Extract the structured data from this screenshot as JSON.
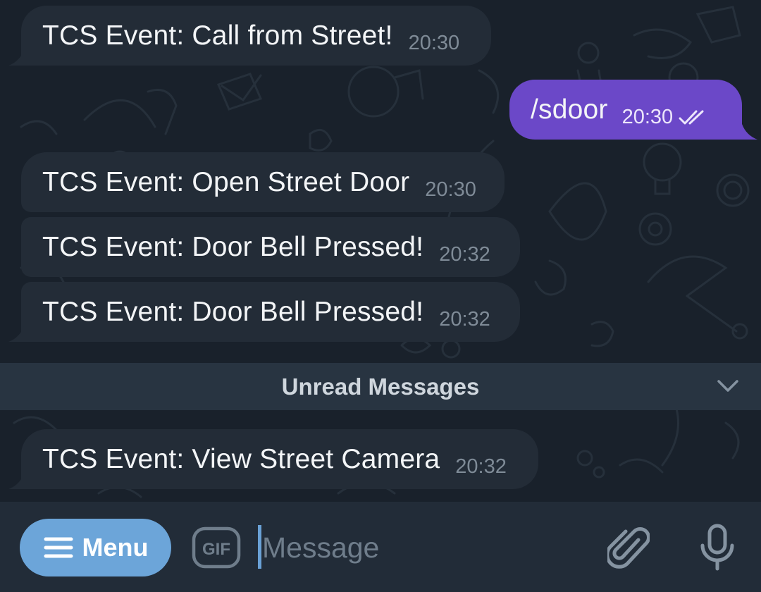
{
  "messages": [
    {
      "text": "TCS Event: Call from Street!",
      "time": "20:30",
      "direction": "incoming"
    },
    {
      "text": "/sdoor",
      "time": "20:30",
      "direction": "outgoing",
      "status": "read"
    },
    {
      "text": "TCS Event: Open Street Door",
      "time": "20:30",
      "direction": "incoming"
    },
    {
      "text": "TCS Event: Door Bell Pressed!",
      "time": "20:32",
      "direction": "incoming"
    },
    {
      "text": "TCS Event: Door Bell Pressed!",
      "time": "20:32",
      "direction": "incoming"
    },
    {
      "text": "TCS Event: View Street Camera",
      "time": "20:32",
      "direction": "incoming"
    }
  ],
  "unread_divider": {
    "label": "Unread Messages",
    "icon": "chevron-down-icon"
  },
  "input_bar": {
    "menu_label": "Menu",
    "gif_label": "GIF",
    "message_placeholder": "Message",
    "message_value": "",
    "icons": [
      "menu-lines-icon",
      "gif-icon",
      "paperclip-icon",
      "microphone-icon"
    ]
  },
  "colors": {
    "background": "#19212b",
    "incoming_bubble": "#232c37",
    "outgoing_bubble": "#6b48c8",
    "menu_button": "#6ca5d9",
    "unread_bar": "#283441"
  }
}
